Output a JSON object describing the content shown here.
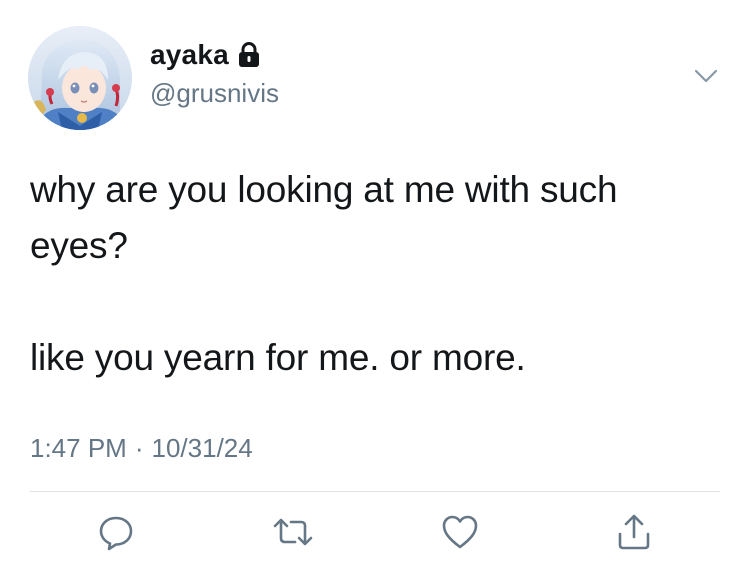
{
  "tweet": {
    "display_name": "ayaka",
    "handle": "@grusnivis",
    "text_lines": [
      "why are you looking at me with such",
      "eyes?",
      "",
      "like you yearn for me. or more."
    ],
    "time": "1:47 PM",
    "separator": "·",
    "date": "10/31/24"
  },
  "icons": {
    "lock": "lock-icon",
    "caret": "chevron-down-icon",
    "reply": "reply-icon",
    "retweet": "retweet-icon",
    "like": "heart-icon",
    "share": "share-icon"
  },
  "colors": {
    "text": "#14171a",
    "secondary": "#657786",
    "icon": "#657786",
    "divider": "#dfe3e6"
  }
}
